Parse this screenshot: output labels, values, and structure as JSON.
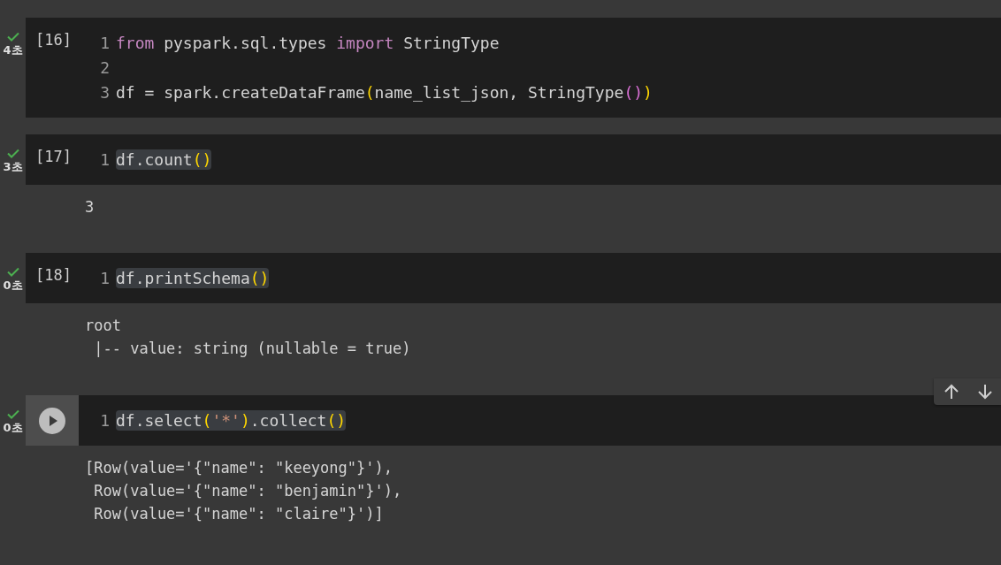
{
  "cells": [
    {
      "status": {
        "done": true,
        "time": "4초"
      },
      "focused": false,
      "execution_count": "[16]",
      "lines": [
        {
          "number": "1",
          "highlighted": false,
          "tokens": [
            {
              "text": "from",
              "kind": "keyword"
            },
            {
              "text": " pyspark.sql.types ",
              "kind": "plain"
            },
            {
              "text": "import",
              "kind": "keyword"
            },
            {
              "text": " StringType",
              "kind": "plain"
            }
          ]
        },
        {
          "number": "2",
          "highlighted": false
        },
        {
          "number": "3",
          "highlighted": false,
          "tokens": [
            {
              "text": "df = spark.createDataFrame",
              "kind": "plain"
            },
            {
              "text": "(",
              "kind": "paren"
            },
            {
              "text": "name_list_json, StringType",
              "kind": "plain"
            },
            {
              "text": "()",
              "kind": "inner_paren"
            },
            {
              "text": ")",
              "kind": "paren"
            }
          ]
        }
      ]
    },
    {
      "status": {
        "done": true,
        "time": "3초"
      },
      "focused": false,
      "execution_count": "[17]",
      "lines": [
        {
          "number": "1",
          "highlighted": true,
          "tokens": [
            {
              "text": "df.count",
              "kind": "plain"
            },
            {
              "text": "()",
              "kind": "paren"
            }
          ]
        }
      ],
      "output": [
        "3"
      ]
    },
    {
      "status": {
        "done": true,
        "time": "0초"
      },
      "focused": false,
      "execution_count": "[18]",
      "lines": [
        {
          "number": "1",
          "highlighted": true,
          "tokens": [
            {
              "text": "df.printSchema",
              "kind": "plain"
            },
            {
              "text": "()",
              "kind": "paren"
            }
          ]
        }
      ],
      "output": [
        "root",
        " |-- value: string (nullable = true)"
      ]
    },
    {
      "status": {
        "done": true,
        "time": "0초"
      },
      "focused": true,
      "lines": [
        {
          "number": "1",
          "highlighted": true,
          "tokens": [
            {
              "text": "df.select",
              "kind": "plain"
            },
            {
              "text": "(",
              "kind": "paren"
            },
            {
              "text": "'*'",
              "kind": "string"
            },
            {
              "text": ")",
              "kind": "paren"
            },
            {
              "text": ".collect",
              "kind": "plain"
            },
            {
              "text": "()",
              "kind": "paren"
            }
          ]
        }
      ],
      "output": [
        "[Row(value='{\"name\": \"keeyong\"}'),",
        " Row(value='{\"name\": \"benjamin\"}'),",
        " Row(value='{\"name\": \"claire\"}')]"
      ]
    }
  ]
}
